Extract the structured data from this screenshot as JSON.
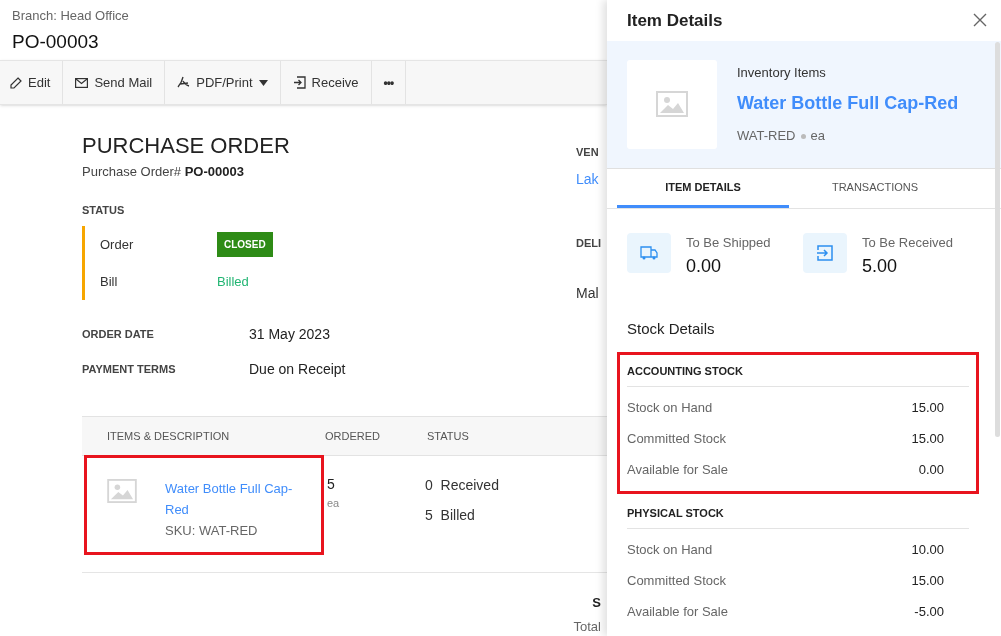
{
  "header": {
    "branch": "Branch: Head Office",
    "number": "PO-00003"
  },
  "toolbar": [
    {
      "kind": "edit",
      "label": "Edit"
    },
    {
      "kind": "mail",
      "label": "Send Mail"
    },
    {
      "kind": "pdf",
      "label": "PDF/Print",
      "dropdown": true
    },
    {
      "kind": "receive",
      "label": "Receive"
    },
    {
      "kind": "more",
      "label": "•••"
    }
  ],
  "document": {
    "title": "PURCHASE ORDER",
    "number_label": "Purchase Order#",
    "number": "PO-00003",
    "status_heading": "STATUS",
    "statuses": [
      {
        "label": "Order",
        "value": "CLOSED",
        "kind": "badge"
      },
      {
        "label": "Bill",
        "value": "Billed",
        "kind": "text"
      }
    ],
    "fields": [
      {
        "label": "ORDER DATE",
        "value": "31 May 2023"
      },
      {
        "label": "PAYMENT TERMS",
        "value": "Due on Receipt"
      }
    ],
    "side": {
      "vendor_label": "VEN",
      "vendor": "Lak",
      "delivery_label": "DELI",
      "delivery": "Mal"
    },
    "table": {
      "columns": [
        "ITEMS & DESCRIPTION",
        "ORDERED",
        "STATUS"
      ],
      "rows": [
        {
          "name": "Water Bottle Full Cap-Red",
          "sku": "SKU: WAT-RED",
          "ordered": "5",
          "unit": "ea",
          "statuses": [
            {
              "count": "0",
              "label": "Received"
            },
            {
              "count": "5",
              "label": "Billed"
            }
          ],
          "highlighted": true
        }
      ]
    },
    "totals": {
      "column_1": "S",
      "column_2": "Total"
    }
  },
  "drawer": {
    "title": "Item Details",
    "category": "Inventory Items",
    "item_name": "Water Bottle Full Cap-Red",
    "sku": "WAT-RED",
    "unit": "ea",
    "tabs": [
      {
        "label": "ITEM DETAILS",
        "selected": true
      },
      {
        "label": "TRANSACTIONS",
        "selected": false
      }
    ],
    "cards": [
      {
        "kind": "ship",
        "label": "To Be Shipped",
        "value": "0.00"
      },
      {
        "kind": "receive",
        "label": "To Be Received",
        "value": "5.00"
      }
    ],
    "stock_title": "Stock Details",
    "sections": [
      {
        "title": "ACCOUNTING STOCK",
        "highlighted": true,
        "rows": [
          {
            "label": "Stock on Hand",
            "value": "15.00"
          },
          {
            "label": "Committed Stock",
            "value": "15.00"
          },
          {
            "label": "Available for Sale",
            "value": "0.00"
          }
        ]
      },
      {
        "title": "PHYSICAL STOCK",
        "highlighted": false,
        "rows": [
          {
            "label": "Stock on Hand",
            "value": "10.00"
          },
          {
            "label": "Committed Stock",
            "value": "15.00"
          },
          {
            "label": "Available for Sale",
            "value": "-5.00"
          }
        ]
      }
    ]
  }
}
